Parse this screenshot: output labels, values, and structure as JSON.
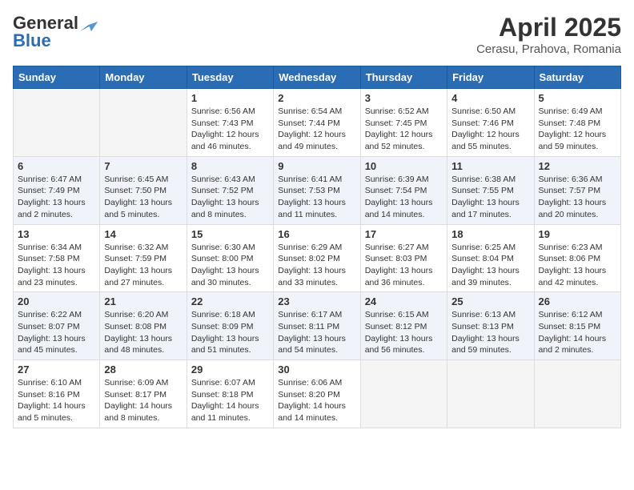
{
  "header": {
    "logo_general": "General",
    "logo_blue": "Blue",
    "month": "April 2025",
    "location": "Cerasu, Prahova, Romania"
  },
  "weekdays": [
    "Sunday",
    "Monday",
    "Tuesday",
    "Wednesday",
    "Thursday",
    "Friday",
    "Saturday"
  ],
  "weeks": [
    [
      {
        "day": "",
        "detail": ""
      },
      {
        "day": "",
        "detail": ""
      },
      {
        "day": "1",
        "detail": "Sunrise: 6:56 AM\nSunset: 7:43 PM\nDaylight: 12 hours and 46 minutes."
      },
      {
        "day": "2",
        "detail": "Sunrise: 6:54 AM\nSunset: 7:44 PM\nDaylight: 12 hours and 49 minutes."
      },
      {
        "day": "3",
        "detail": "Sunrise: 6:52 AM\nSunset: 7:45 PM\nDaylight: 12 hours and 52 minutes."
      },
      {
        "day": "4",
        "detail": "Sunrise: 6:50 AM\nSunset: 7:46 PM\nDaylight: 12 hours and 55 minutes."
      },
      {
        "day": "5",
        "detail": "Sunrise: 6:49 AM\nSunset: 7:48 PM\nDaylight: 12 hours and 59 minutes."
      }
    ],
    [
      {
        "day": "6",
        "detail": "Sunrise: 6:47 AM\nSunset: 7:49 PM\nDaylight: 13 hours and 2 minutes."
      },
      {
        "day": "7",
        "detail": "Sunrise: 6:45 AM\nSunset: 7:50 PM\nDaylight: 13 hours and 5 minutes."
      },
      {
        "day": "8",
        "detail": "Sunrise: 6:43 AM\nSunset: 7:52 PM\nDaylight: 13 hours and 8 minutes."
      },
      {
        "day": "9",
        "detail": "Sunrise: 6:41 AM\nSunset: 7:53 PM\nDaylight: 13 hours and 11 minutes."
      },
      {
        "day": "10",
        "detail": "Sunrise: 6:39 AM\nSunset: 7:54 PM\nDaylight: 13 hours and 14 minutes."
      },
      {
        "day": "11",
        "detail": "Sunrise: 6:38 AM\nSunset: 7:55 PM\nDaylight: 13 hours and 17 minutes."
      },
      {
        "day": "12",
        "detail": "Sunrise: 6:36 AM\nSunset: 7:57 PM\nDaylight: 13 hours and 20 minutes."
      }
    ],
    [
      {
        "day": "13",
        "detail": "Sunrise: 6:34 AM\nSunset: 7:58 PM\nDaylight: 13 hours and 23 minutes."
      },
      {
        "day": "14",
        "detail": "Sunrise: 6:32 AM\nSunset: 7:59 PM\nDaylight: 13 hours and 27 minutes."
      },
      {
        "day": "15",
        "detail": "Sunrise: 6:30 AM\nSunset: 8:00 PM\nDaylight: 13 hours and 30 minutes."
      },
      {
        "day": "16",
        "detail": "Sunrise: 6:29 AM\nSunset: 8:02 PM\nDaylight: 13 hours and 33 minutes."
      },
      {
        "day": "17",
        "detail": "Sunrise: 6:27 AM\nSunset: 8:03 PM\nDaylight: 13 hours and 36 minutes."
      },
      {
        "day": "18",
        "detail": "Sunrise: 6:25 AM\nSunset: 8:04 PM\nDaylight: 13 hours and 39 minutes."
      },
      {
        "day": "19",
        "detail": "Sunrise: 6:23 AM\nSunset: 8:06 PM\nDaylight: 13 hours and 42 minutes."
      }
    ],
    [
      {
        "day": "20",
        "detail": "Sunrise: 6:22 AM\nSunset: 8:07 PM\nDaylight: 13 hours and 45 minutes."
      },
      {
        "day": "21",
        "detail": "Sunrise: 6:20 AM\nSunset: 8:08 PM\nDaylight: 13 hours and 48 minutes."
      },
      {
        "day": "22",
        "detail": "Sunrise: 6:18 AM\nSunset: 8:09 PM\nDaylight: 13 hours and 51 minutes."
      },
      {
        "day": "23",
        "detail": "Sunrise: 6:17 AM\nSunset: 8:11 PM\nDaylight: 13 hours and 54 minutes."
      },
      {
        "day": "24",
        "detail": "Sunrise: 6:15 AM\nSunset: 8:12 PM\nDaylight: 13 hours and 56 minutes."
      },
      {
        "day": "25",
        "detail": "Sunrise: 6:13 AM\nSunset: 8:13 PM\nDaylight: 13 hours and 59 minutes."
      },
      {
        "day": "26",
        "detail": "Sunrise: 6:12 AM\nSunset: 8:15 PM\nDaylight: 14 hours and 2 minutes."
      }
    ],
    [
      {
        "day": "27",
        "detail": "Sunrise: 6:10 AM\nSunset: 8:16 PM\nDaylight: 14 hours and 5 minutes."
      },
      {
        "day": "28",
        "detail": "Sunrise: 6:09 AM\nSunset: 8:17 PM\nDaylight: 14 hours and 8 minutes."
      },
      {
        "day": "29",
        "detail": "Sunrise: 6:07 AM\nSunset: 8:18 PM\nDaylight: 14 hours and 11 minutes."
      },
      {
        "day": "30",
        "detail": "Sunrise: 6:06 AM\nSunset: 8:20 PM\nDaylight: 14 hours and 14 minutes."
      },
      {
        "day": "",
        "detail": ""
      },
      {
        "day": "",
        "detail": ""
      },
      {
        "day": "",
        "detail": ""
      }
    ]
  ]
}
